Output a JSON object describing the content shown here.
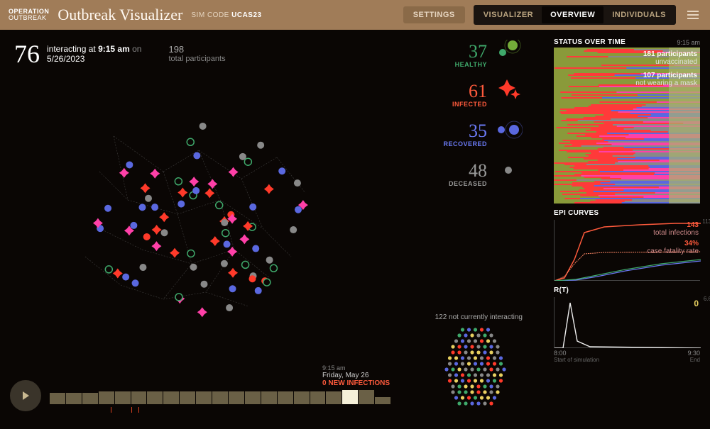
{
  "header": {
    "logo_line1": "OPERATION",
    "logo_line2": "OUTBREAK",
    "title": "Outbreak Visualizer",
    "sim_code_label": "SIM CODE",
    "sim_code_value": "UCAS23",
    "settings": "SETTINGS",
    "tabs": [
      "VISUALIZER",
      "OVERVIEW",
      "INDIVIDUALS"
    ],
    "active_tab": 1
  },
  "interacting": {
    "count": "76",
    "text1": "interacting at",
    "time": "9:15 am",
    "text2": "on",
    "date": "5/26/2023",
    "total_n": "198",
    "total_label": "total participants"
  },
  "tallies": {
    "healthy": {
      "n": "37",
      "label": "HEALTHY"
    },
    "infected": {
      "n": "61",
      "label": "INFECTED"
    },
    "recovered": {
      "n": "35",
      "label": "RECOVERED"
    },
    "deceased": {
      "n": "48",
      "label": "DECEASED"
    }
  },
  "not_interacting": {
    "n": "122",
    "label": "not currently interacting"
  },
  "timeline": {
    "time": "9:15 am",
    "day": "Friday, May 26",
    "new_infections": "0 NEW INFECTIONS"
  },
  "sidebar": {
    "status_title": "STATUS OVER TIME",
    "status_time": "9:15 am",
    "status_p1_n": "181 participants",
    "status_p1_l": "unvaccinated",
    "status_p2_n": "107 participants",
    "status_p2_l": "not wearing a mask",
    "epi_title": "EPI CURVES",
    "epi_ti_n": "143",
    "epi_ti_l": "total infections",
    "epi_cf_n": "34%",
    "epi_cf_l": "case fatality rate",
    "epi_ymax": "113",
    "rt_title": "R(T)",
    "rt_value": "0",
    "rt_ymax": "6.6",
    "axis_start_t": "8:00",
    "axis_start_l": "Start of simulation",
    "axis_end_t": "9:30",
    "axis_end_l": "End"
  },
  "chart_data": {
    "timeline_bars": [
      16,
      16,
      16,
      18,
      18,
      18,
      18,
      18,
      18,
      18,
      18,
      18,
      18,
      18,
      18,
      18,
      18,
      18,
      20,
      20,
      10
    ],
    "timeline_current_index": 18,
    "timeline_infection_markers": [
      0.18,
      0.24,
      0.26
    ],
    "epi_curves": {
      "type": "line",
      "x_range": [
        "8:00",
        "9:30"
      ],
      "ylim": [
        0,
        113
      ],
      "series": [
        {
          "name": "total infections",
          "color": "#ff5a3c",
          "values": [
            0,
            5,
            40,
            110,
            130,
            140,
            142,
            143
          ]
        },
        {
          "name": "case fatality rate",
          "color": "#ff8866",
          "values_pct": [
            0,
            10,
            28,
            32,
            33,
            34,
            34,
            34
          ]
        },
        {
          "name": "recovered",
          "color": "#6b7af5",
          "values": [
            0,
            0,
            3,
            10,
            18,
            25,
            31,
            35
          ]
        },
        {
          "name": "healthy",
          "color": "#3fa96b",
          "values": [
            0,
            2,
            8,
            15,
            22,
            28,
            33,
            37
          ]
        }
      ]
    },
    "rt": {
      "type": "line",
      "x_range": [
        "8:00",
        "9:30"
      ],
      "ylim": [
        0,
        6.6
      ],
      "values": [
        0,
        0,
        5.8,
        0.4,
        0.1,
        0,
        0,
        0
      ]
    },
    "status_over_time": {
      "type": "stacked-row-timeline",
      "rows": 198,
      "states": [
        "healthy",
        "infected",
        "recovered",
        "deceased"
      ],
      "colors": {
        "healthy": "#8a9a3a",
        "infected": "#ff3a3a",
        "recovered": "#6b7af5",
        "deceased": "#ff60b8"
      },
      "note": "each row is one participant's state over time"
    }
  }
}
